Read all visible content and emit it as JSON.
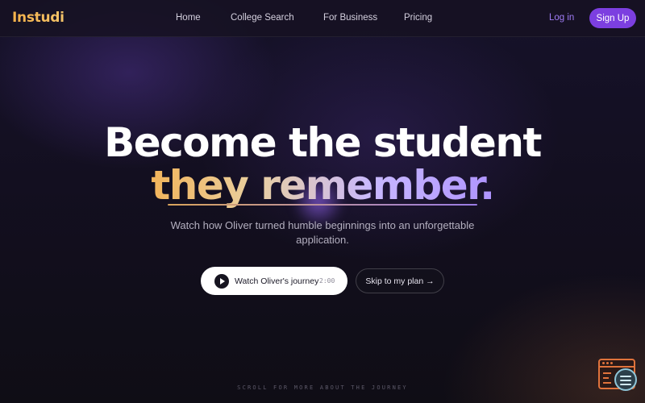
{
  "brand": {
    "name": "Instudi"
  },
  "nav": {
    "links": [
      "Home",
      "College Search",
      "For Business",
      "Pricing"
    ],
    "login_label": "Log in",
    "signup_label": "Sign Up"
  },
  "hero": {
    "title_line1": "Become the student",
    "title_line2": "they remember.",
    "subtitle": "Watch how Oliver turned humble beginnings into an unforgettable application.",
    "primary_button": {
      "label": "Watch Oliver's journey",
      "duration": "2:00",
      "icon": "play-icon"
    },
    "secondary_button": {
      "label": "Skip to my plan →"
    },
    "scroll_hint": "SCROLL FOR MORE ABOUT THE JOURNEY"
  },
  "widget": {
    "icon": "chat-window-icon"
  },
  "colors": {
    "accent": "#7c3fe0",
    "login": "#9f7cf5",
    "brand": "#f6b24a",
    "title_gradient_start": "#f2b45a",
    "title_gradient_end": "#ae93ff",
    "widget": "#e0733c"
  }
}
